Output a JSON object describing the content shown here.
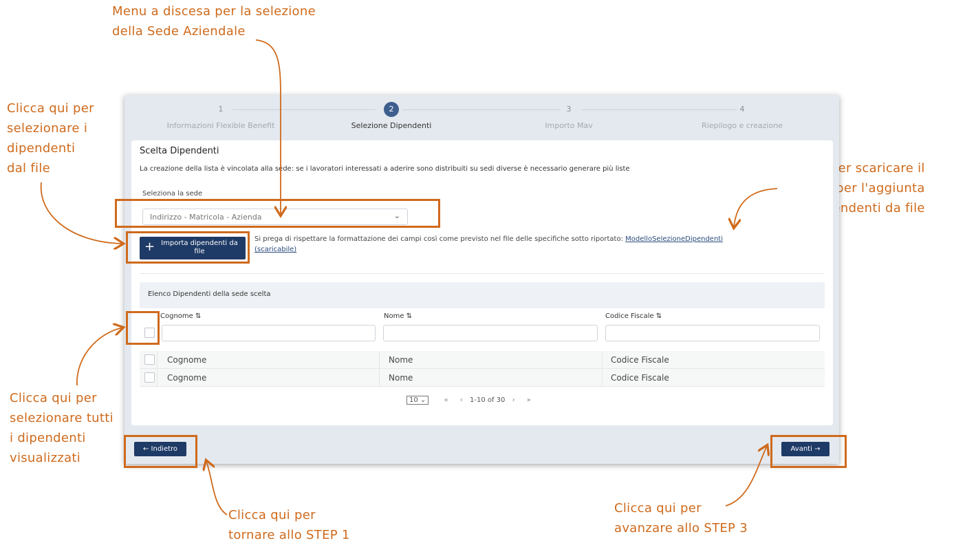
{
  "annotations": {
    "dropdown_note": "Menu a discesa per la selezione\ndella Sede Aziendale",
    "import_note": "Clicca qui per\nselezionare i\ndipendenti\ndal file",
    "link_note": "Link per scaricare il\nmodello per l'aggiunta\ndei dipendenti da file",
    "select_all_note": "Clicca qui per\nselezionare tutti\ni dipendenti\nvisualizzati",
    "back_note": "Clicca qui per\ntornare allo STEP 1",
    "next_note": "Clicca qui per\navanzare allo STEP 3",
    "highlight_color": "#cf6a1c"
  },
  "stepper": {
    "steps": [
      {
        "num": "1",
        "label": "Informazioni Flexible Benefit"
      },
      {
        "num": "2",
        "label": "Selezione Dipendenti"
      },
      {
        "num": "3",
        "label": "Importo Mav"
      },
      {
        "num": "4",
        "label": "Riepilogo e creazione"
      }
    ],
    "active_color": "#3e5f8e"
  },
  "card": {
    "title": "Scelta Dipendenti",
    "description": "La creazione della lista è vincolata alla sede: se i lavoratori interessati a aderire sono distribuiti su sedi diverse è necessario generare più liste",
    "sede_label": "Seleziona la sede",
    "sede_placeholder": "Indirizzo - Matricola - Azienda",
    "import_button": "Importa dipendenti da file",
    "import_note": "Si prega di rispettare la formattazione dei campi così come previsto nel file delle specifiche sotto riportato:",
    "model_link": "ModelloSelezioneDipendenti",
    "model_link_suffix": "(scaricabile)"
  },
  "table": {
    "header": "Elenco Dipendenti della sede scelta",
    "columns": [
      "Cognome ⇅",
      "Nome ⇅",
      "Codice Fiscale ⇅"
    ],
    "rows": [
      [
        "Cognome",
        "Nome",
        "Codice Fiscale"
      ],
      [
        "Cognome",
        "Nome",
        "Codice Fiscale"
      ]
    ]
  },
  "pagination": {
    "page_size": "10",
    "range": "1-10 of 30"
  },
  "footer": {
    "back_button": "← Indietro",
    "next_button": "Avanti →"
  },
  "brand_color": "#1e3a66"
}
